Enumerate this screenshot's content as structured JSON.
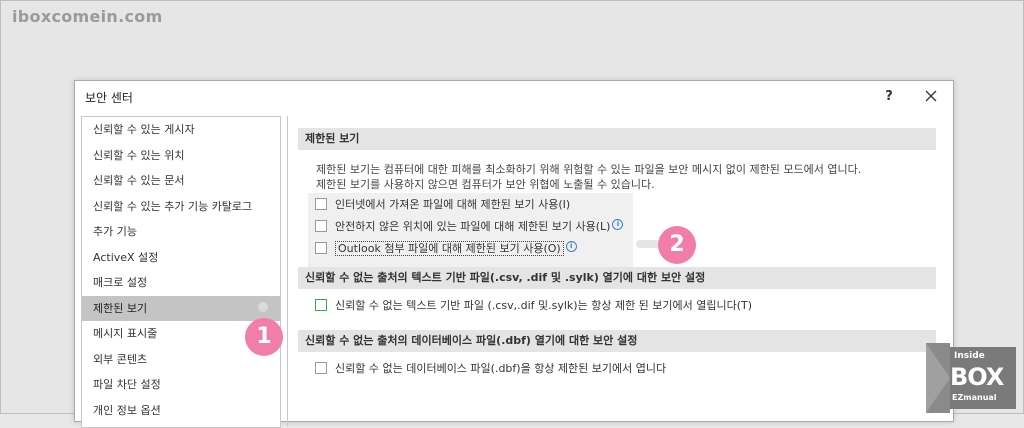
{
  "watermark": "iboxcomein.com",
  "dialog": {
    "title": "보안 센터",
    "help_label": "?"
  },
  "sidebar": {
    "items": [
      {
        "label": "신뢰할 수 있는 게시자"
      },
      {
        "label": "신뢰할 수 있는 위치"
      },
      {
        "label": "신뢰할 수 있는 문서"
      },
      {
        "label": "신뢰할 수 있는 추가 기능 카탈로그"
      },
      {
        "label": "추가 기능"
      },
      {
        "label": "ActiveX 설정"
      },
      {
        "label": "매크로 설정"
      },
      {
        "label": "제한된 보기"
      },
      {
        "label": "메시지 표시줄"
      },
      {
        "label": "외부 콘텐츠"
      },
      {
        "label": "파일 차단 설정"
      },
      {
        "label": "개인 정보 옵션"
      }
    ],
    "active_index": 7
  },
  "protected_view": {
    "heading": "제한된 보기",
    "desc_line1": "제한된 보기는 컴퓨터에 대한 피해를 최소화하기 위해 위험할 수 있는 파일을 보안 메시지 없이 제한된 모드에서 엽니다.",
    "desc_line2": "제한된 보기를 사용하지 않으면 컴퓨터가 보안 위협에 노출될 수 있습니다.",
    "options": [
      {
        "label": "인터넷에서 가져온 파일에 대해 제한된 보기 사용(I)",
        "checked": false,
        "info": false
      },
      {
        "label": "안전하지 않은 위치에 있는 파일에 대해 제한된 보기 사용(L)",
        "checked": false,
        "info": true
      },
      {
        "label": "Outlook 첨부 파일에 대해 제한된 보기 사용(O)",
        "checked": false,
        "info": true
      }
    ]
  },
  "text_files": {
    "heading": "신뢰할 수 없는 출처의 텍스트 기반 파일(.csv, .dif 및 .sylk) 열기에 대한 보안 설정",
    "option_label": "신뢰할 수 없는 텍스트 기반 파일 (.csv,.dif 및.sylk)는 항상 제한 된 보기에서 열립니다(T)"
  },
  "db_files": {
    "heading": "신뢰할 수 없는 출처의 데이터베이스 파일(.dbf) 열기에 대한 보안 설정",
    "option_label": "신뢰할 수 없는 데이터베이스 파일(.dbf)을 항상 제한된 보기에서 엽니다"
  },
  "annotations": {
    "badge1": "1",
    "badge2": "2"
  },
  "logo": {
    "line1": "Inside",
    "line2": "BOX",
    "line3": "EZmanual"
  },
  "colors": {
    "badge": "#f07ea8",
    "active_item": "#c4c4c4",
    "section_bg": "#e4e4e4",
    "info_blue": "#3f7fcf"
  }
}
